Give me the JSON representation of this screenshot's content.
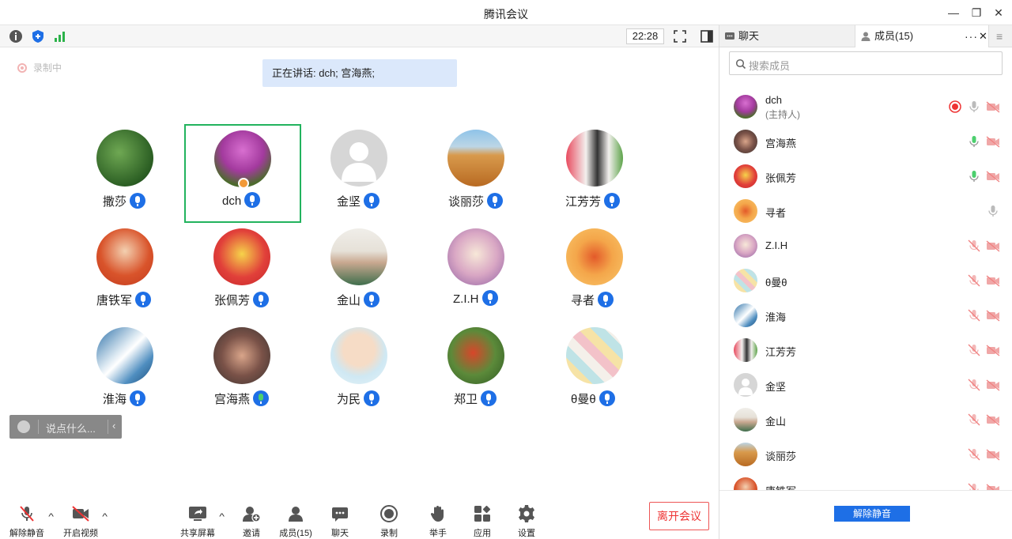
{
  "window": {
    "title": "腾讯会议"
  },
  "toolbar": {
    "clock": "22:28"
  },
  "recording": {
    "label": "录制中"
  },
  "speaking": {
    "text": "正在讲话: dch; 宫海燕;"
  },
  "chat_input": {
    "placeholder": "说点什么..."
  },
  "participants": [
    {
      "name": "撒莎",
      "mic": "on"
    },
    {
      "name": "dch",
      "mic": "on",
      "active": true
    },
    {
      "name": "金坚",
      "mic": "on"
    },
    {
      "name": "谈丽莎",
      "mic": "on"
    },
    {
      "name": "江芳芳",
      "mic": "on"
    },
    {
      "name": "唐铁军",
      "mic": "on"
    },
    {
      "name": "张佩芳",
      "mic": "on"
    },
    {
      "name": "金山",
      "mic": "on"
    },
    {
      "name": "Z.I.H",
      "mic": "on"
    },
    {
      "name": "寻者",
      "mic": "on"
    },
    {
      "name": "淮海",
      "mic": "on"
    },
    {
      "name": "宫海燕",
      "mic": "speaking"
    },
    {
      "name": "为民",
      "mic": "on"
    },
    {
      "name": "郑卫",
      "mic": "on"
    },
    {
      "name": "θ曼θ",
      "mic": "on"
    }
  ],
  "bottombar": {
    "unmute": "解除静音",
    "video": "开启视频",
    "share": "共享屏幕",
    "invite": "邀请",
    "members": "成员(15)",
    "chat": "聊天",
    "record": "录制",
    "raise_hand": "举手",
    "apps": "应用",
    "settings": "设置",
    "leave": "离开会议"
  },
  "panel": {
    "tab_chat": "聊天",
    "tab_members": "成员(15)",
    "search_placeholder": "搜索成员",
    "unmute_all": "解除静音",
    "members": [
      {
        "name": "dch",
        "role": "(主持人)",
        "mic": "host",
        "rec": true
      },
      {
        "name": "宫海燕",
        "mic": "speaking"
      },
      {
        "name": "张佩芳",
        "mic": "speaking"
      },
      {
        "name": "寻者",
        "mic": "on-grey"
      },
      {
        "name": "Z.I.H",
        "mic": "muted"
      },
      {
        "name": "θ曼θ",
        "mic": "muted"
      },
      {
        "name": "淮海",
        "mic": "muted"
      },
      {
        "name": "江芳芳",
        "mic": "muted"
      },
      {
        "name": "金坚",
        "mic": "muted"
      },
      {
        "name": "金山",
        "mic": "muted"
      },
      {
        "name": "谈丽莎",
        "mic": "muted"
      },
      {
        "name": "唐铁军",
        "mic": "muted"
      }
    ]
  },
  "colors": {
    "accent": "#1e6fe6",
    "active_border": "#22b35e",
    "leave": "#e33333",
    "speaking_bg": "#dbe8fb"
  }
}
